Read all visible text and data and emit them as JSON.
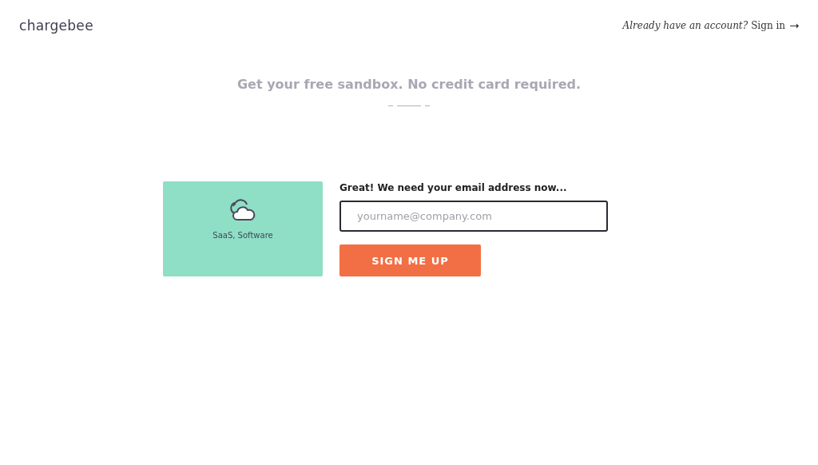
{
  "header": {
    "logo": "chargebee",
    "account_prompt": "Already have an account?",
    "sign_in_link": "Sign in"
  },
  "headline": "Get your free sandbox. No credit card required.",
  "category_card": {
    "label": "SaaS, Software"
  },
  "form": {
    "heading": "Great! We need your email address now...",
    "email": {
      "placeholder": "yourname@company.com"
    },
    "submit": "SIGN ME UP"
  }
}
